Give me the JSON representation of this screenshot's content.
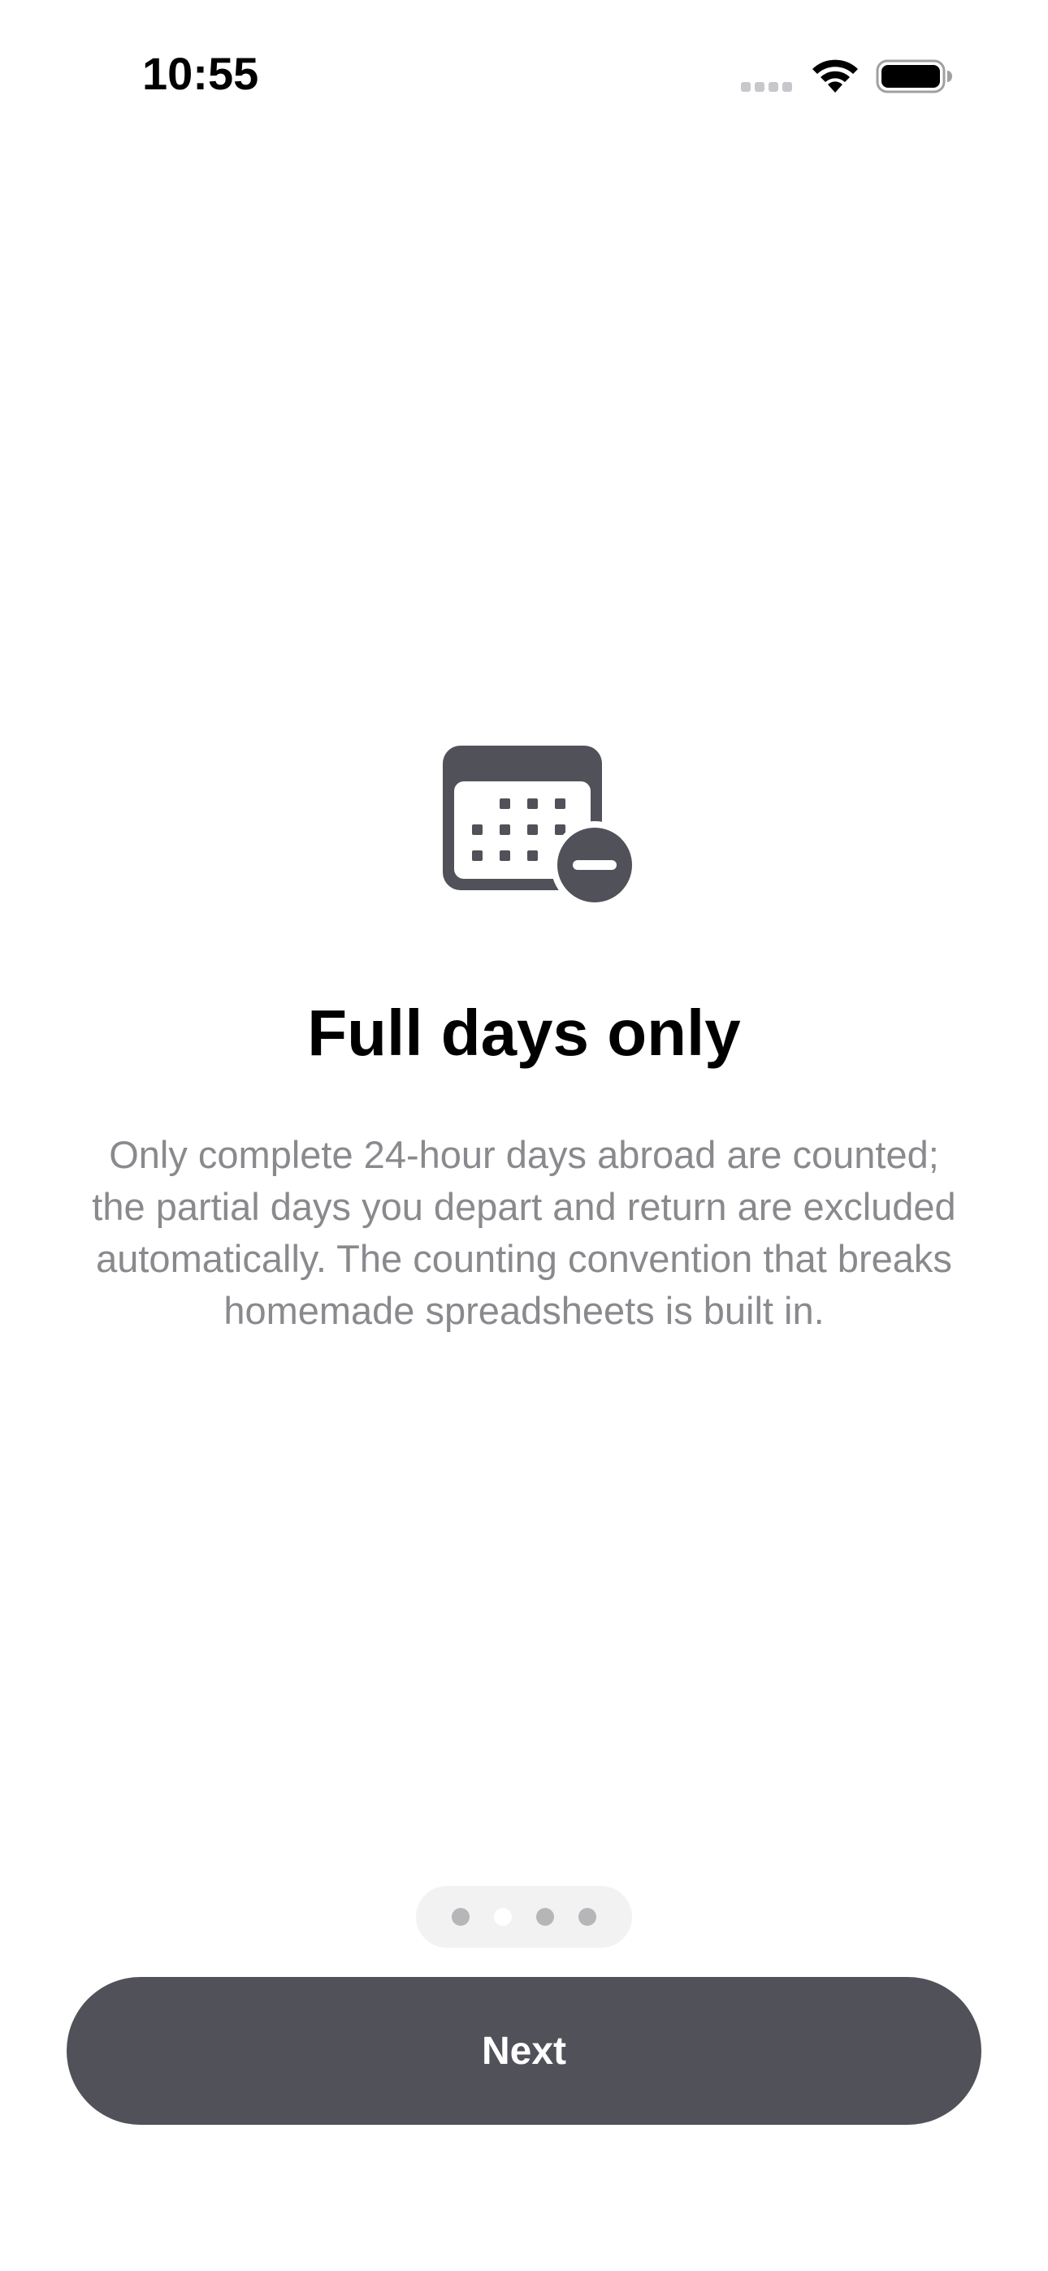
{
  "status_bar": {
    "time": "10:55"
  },
  "onboarding": {
    "icon": "calendar-minus-icon",
    "title": "Full days only",
    "body": "Only complete 24-hour days abroad are counted; the partial days you depart and return are excluded automatically. The counting convention that breaks homemade spreadsheets is built in.",
    "page_indicator": {
      "total": 4,
      "current": 2
    }
  },
  "footer": {
    "next_label": "Next"
  },
  "colors": {
    "accent": "#515159",
    "icon": "#515159",
    "body_text": "#8a8a8e",
    "background": "#ffffff"
  }
}
